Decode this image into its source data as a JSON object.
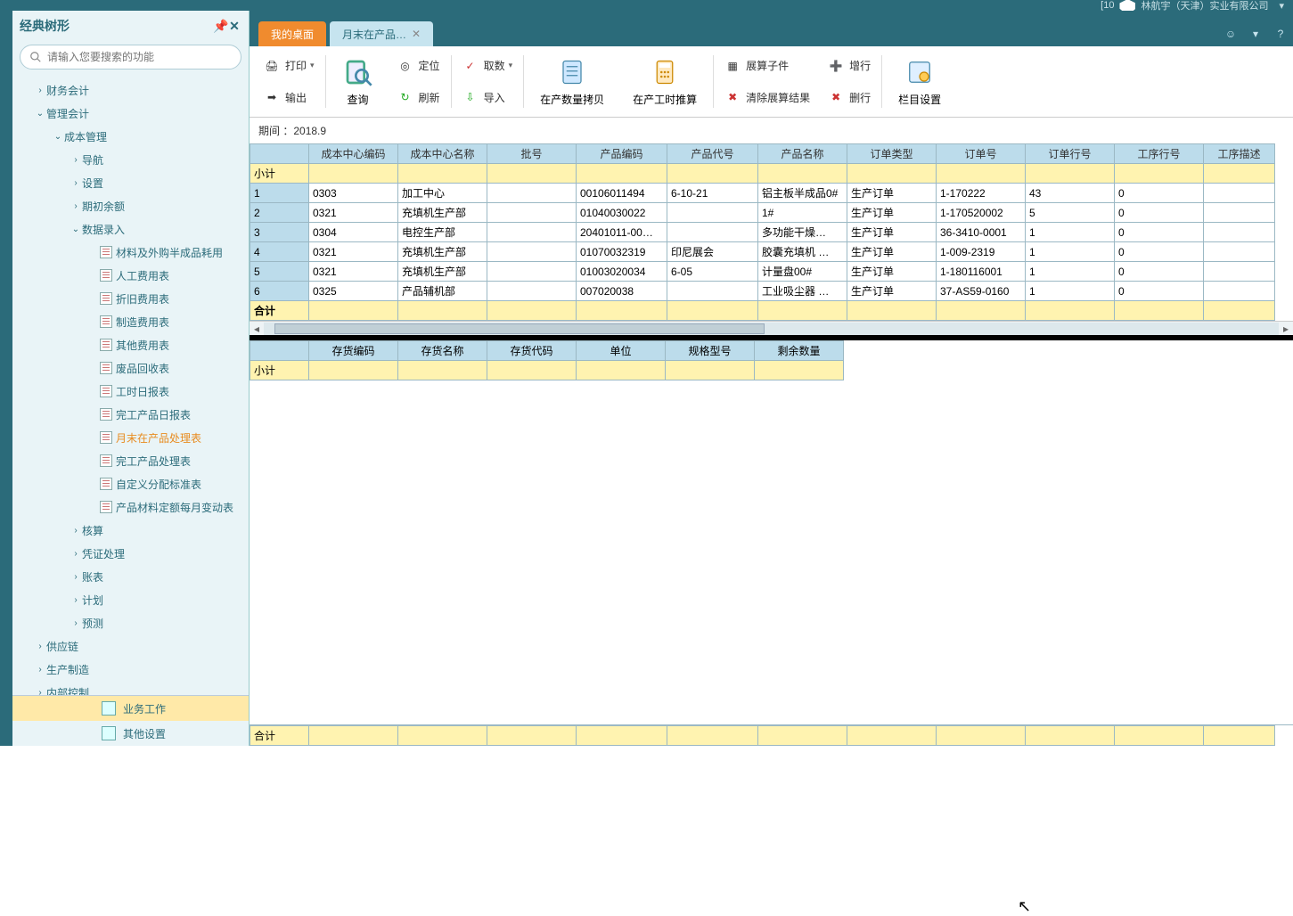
{
  "titlebar": {
    "company": "林航宇（天津）实业有限公司"
  },
  "sidebar": {
    "title": "经典树形",
    "search_placeholder": "请输入您要搜索的功能",
    "nodes": [
      {
        "lvl": 0,
        "arrow": "›",
        "label": "财务会计"
      },
      {
        "lvl": 0,
        "arrow": "⌄",
        "label": "管理会计"
      },
      {
        "lvl": 1,
        "arrow": "⌄",
        "label": "成本管理"
      },
      {
        "lvl": 2,
        "arrow": "›",
        "label": "导航"
      },
      {
        "lvl": 2,
        "arrow": "›",
        "label": "设置"
      },
      {
        "lvl": 2,
        "arrow": "›",
        "label": "期初余额"
      },
      {
        "lvl": 2,
        "arrow": "⌄",
        "label": "数据录入"
      },
      {
        "lvl": 3,
        "doc": true,
        "label": "材料及外购半成品耗用"
      },
      {
        "lvl": 3,
        "doc": true,
        "label": "人工费用表"
      },
      {
        "lvl": 3,
        "doc": true,
        "label": "折旧费用表"
      },
      {
        "lvl": 3,
        "doc": true,
        "label": "制造费用表"
      },
      {
        "lvl": 3,
        "doc": true,
        "label": "其他费用表"
      },
      {
        "lvl": 3,
        "doc": true,
        "label": "废品回收表"
      },
      {
        "lvl": 3,
        "doc": true,
        "label": "工时日报表"
      },
      {
        "lvl": 3,
        "doc": true,
        "label": "完工产品日报表"
      },
      {
        "lvl": 3,
        "doc": true,
        "label": "月末在产品处理表",
        "active": true
      },
      {
        "lvl": 3,
        "doc": true,
        "label": "完工产品处理表"
      },
      {
        "lvl": 3,
        "doc": true,
        "label": "自定义分配标准表"
      },
      {
        "lvl": 3,
        "doc": true,
        "label": "产品材料定额每月变动表"
      },
      {
        "lvl": 2,
        "arrow": "›",
        "label": "核算"
      },
      {
        "lvl": 2,
        "arrow": "›",
        "label": "凭证处理"
      },
      {
        "lvl": 2,
        "arrow": "›",
        "label": "账表"
      },
      {
        "lvl": 2,
        "arrow": "›",
        "label": "计划"
      },
      {
        "lvl": 2,
        "arrow": "›",
        "label": "预测"
      },
      {
        "lvl": 0,
        "arrow": "›",
        "label": "供应链"
      },
      {
        "lvl": 0,
        "arrow": "›",
        "label": "生产制造"
      },
      {
        "lvl": 0,
        "arrow": "›",
        "label": "内部控制"
      }
    ],
    "footer": [
      {
        "label": "业务工作",
        "selected": true
      },
      {
        "label": "其他设置"
      }
    ]
  },
  "tabs": [
    {
      "label": "我的桌面",
      "active": false
    },
    {
      "label": "月末在产品…",
      "active": true,
      "closable": true
    }
  ],
  "toolbar": {
    "print": "打印",
    "export": "输出",
    "query": "查询",
    "locate": "定位",
    "refresh": "刷新",
    "fetch": "取数",
    "import": "导入",
    "copyqty": "在产数量拷贝",
    "calc": "在产工时推算",
    "expand": "展算子件",
    "clear": "清除展算结果",
    "addrow": "增行",
    "delrow": "删行",
    "cols": "栏目设置"
  },
  "period": {
    "label": "期间 ：",
    "value": "2018.9"
  },
  "grid1": {
    "headers": [
      "成本中心编码",
      "成本中心名称",
      "批号",
      "产品编码",
      "产品代号",
      "产品名称",
      "订单类型",
      "订单号",
      "订单行号",
      "工序行号",
      "工序描述"
    ],
    "subtotal": "小计",
    "total": "合计",
    "rows": [
      {
        "n": "1",
        "a": "0303",
        "b": "加工中心",
        "c": "",
        "d": "00106011494",
        "e": "6-10-21",
        "f": "铝主板半成品0#",
        "g": "生产订单",
        "h": "1-170222",
        "i": "43",
        "j": "0"
      },
      {
        "n": "2",
        "a": "0321",
        "b": "充填机生产部",
        "c": "",
        "d": "01040030022",
        "e": "",
        "f": "1#",
        "g": "生产订单",
        "h": "1-170520002",
        "i": "5",
        "j": "0"
      },
      {
        "n": "3",
        "a": "0304",
        "b": "电控生产部",
        "c": "",
        "d": "20401011-00…",
        "e": "",
        "f": "多功能干燥…",
        "g": "生产订单",
        "h": "36-3410-0001",
        "i": "1",
        "j": "0",
        "dashed": true
      },
      {
        "n": "4",
        "a": "0321",
        "b": "充填机生产部",
        "c": "",
        "d": "01070032319",
        "e": "印尼展会",
        "f": "胶囊充填机 …",
        "g": "生产订单",
        "h": "1-009-2319",
        "i": "1",
        "j": "0"
      },
      {
        "n": "5",
        "a": "0321",
        "b": "充填机生产部",
        "c": "",
        "d": "01003020034",
        "e": "6-05",
        "f": "计量盘00#",
        "g": "生产订单",
        "h": "1-180116001",
        "i": "1",
        "j": "0"
      },
      {
        "n": "6",
        "a": "0325",
        "b": "产品辅机部",
        "c": "",
        "d": "007020038",
        "e": "",
        "f": "工业吸尘器 …",
        "g": "生产订单",
        "h": "37-AS59-0160",
        "i": "1",
        "j": "0"
      }
    ]
  },
  "grid2": {
    "headers": [
      "存货编码",
      "存货名称",
      "存货代码",
      "单位",
      "规格型号",
      "剩余数量"
    ],
    "subtotal": "小计"
  },
  "footer_total": "合计"
}
